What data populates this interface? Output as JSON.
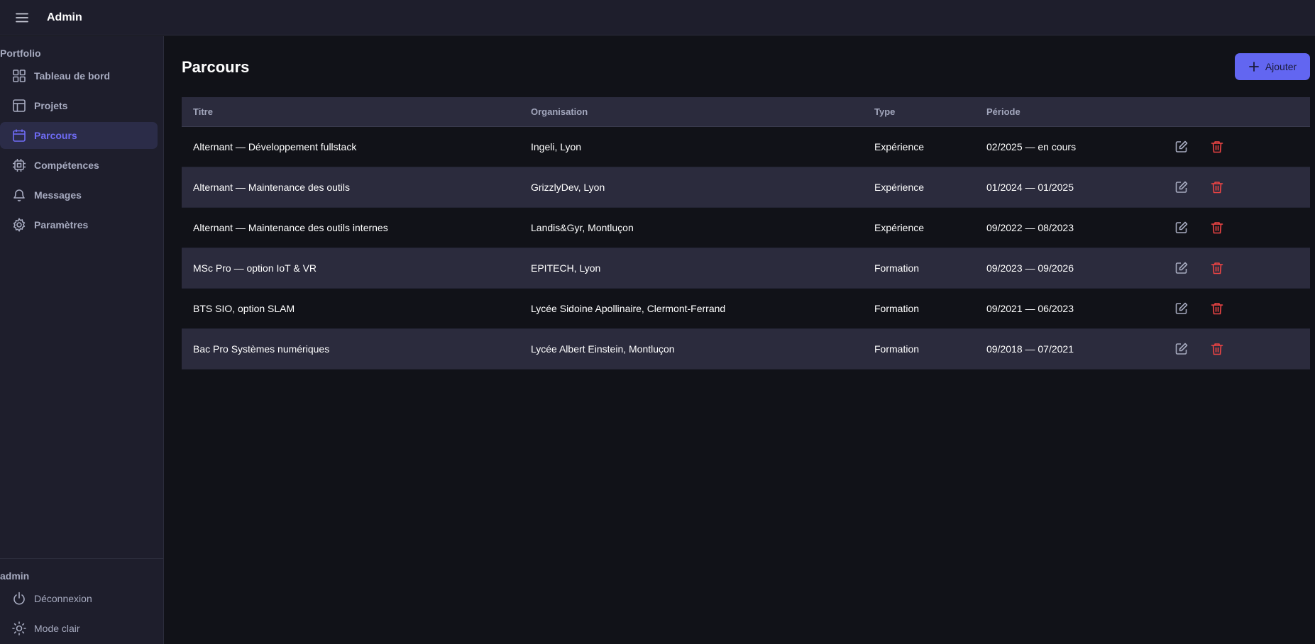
{
  "header": {
    "title": "Admin",
    "menu_icon": "hamburger-icon"
  },
  "sidebar": {
    "section_title": "Portfolio",
    "items": [
      {
        "label": "Tableau de bord",
        "icon": "dashboard-icon"
      },
      {
        "label": "Projets",
        "icon": "layout-icon"
      },
      {
        "label": "Parcours",
        "icon": "calendar-icon",
        "active": true
      },
      {
        "label": "Compétences",
        "icon": "chip-icon"
      },
      {
        "label": "Messages",
        "icon": "bell-icon"
      },
      {
        "label": "Paramètres",
        "icon": "gear-icon"
      }
    ],
    "footer_title": "admin",
    "footer_items": [
      {
        "label": "Déconnexion",
        "icon": "power-icon"
      },
      {
        "label": "Mode clair",
        "icon": "sun-icon"
      }
    ]
  },
  "main": {
    "title": "Parcours",
    "add_button": "Ajouter",
    "table": {
      "headers": [
        "Titre",
        "Organisation",
        "Type",
        "Période"
      ],
      "rows": [
        {
          "titre": "Alternant — Développement fullstack",
          "organisation": "Ingeli, Lyon",
          "type": "Expérience",
          "periode": "02/2025 — en cours"
        },
        {
          "titre": "Alternant — Maintenance des outils",
          "organisation": "GrizzlyDev, Lyon",
          "type": "Expérience",
          "periode": "01/2024 — 01/2025"
        },
        {
          "titre": "Alternant — Maintenance des outils internes",
          "organisation": "Landis&Gyr, Montluçon",
          "type": "Expérience",
          "periode": "09/2022 — 08/2023"
        },
        {
          "titre": "MSc Pro — option IoT & VR",
          "organisation": "EPITECH, Lyon",
          "type": "Formation",
          "periode": "09/2023 — 09/2026"
        },
        {
          "titre": "BTS SIO, option SLAM",
          "organisation": "Lycée Sidoine Apollinaire, Clermont-Ferrand",
          "type": "Formation",
          "periode": "09/2021 — 06/2023"
        },
        {
          "titre": "Bac Pro Systèmes numériques",
          "organisation": "Lycée Albert Einstein, Montluçon",
          "type": "Formation",
          "periode": "09/2018 — 07/2021"
        }
      ]
    }
  },
  "colors": {
    "accent": "#6266f1",
    "active_text": "#6f6cf5",
    "delete": "#ef4444",
    "background": "#111218",
    "surface": "#1e1e2c"
  }
}
